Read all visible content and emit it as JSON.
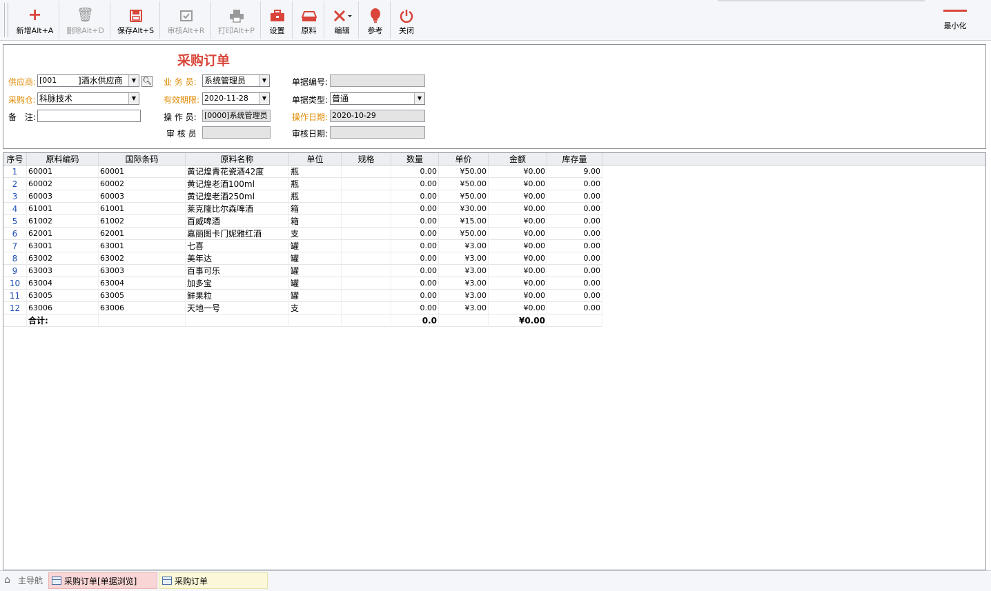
{
  "toolbar": {
    "buttons": [
      {
        "label": "新增Alt+A",
        "icon": "plus-icon",
        "color": "#d9453a"
      },
      {
        "label": "删除Alt+D",
        "icon": "trash-icon",
        "color": "#9a9a9a"
      },
      {
        "label": "保存Alt+S",
        "icon": "save-icon",
        "color": "#d9453a"
      },
      {
        "label": "审核Alt+R",
        "icon": "approve-icon",
        "color": "#9a9a9a"
      },
      {
        "label": "打印Alt+P",
        "icon": "print-icon",
        "color": "#9a9a9a"
      },
      {
        "label": "设置",
        "icon": "toolbox-icon",
        "color": "#d9453a"
      },
      {
        "label": "原料",
        "icon": "material-icon",
        "color": "#d9453a"
      },
      {
        "label": "编辑",
        "icon": "edit-tools-icon",
        "color": "#d9453a"
      },
      {
        "label": "参考",
        "icon": "bulb-icon",
        "color": "#d9453a"
      },
      {
        "label": "关闭",
        "icon": "power-icon",
        "color": "#d9453a"
      }
    ],
    "minimize_label": "最小化"
  },
  "form": {
    "title": "采购订单",
    "supplier_label": "供应商:",
    "supplier_code": "[001",
    "supplier_name": "]酒水供应商",
    "warehouse_label": "采购仓:",
    "warehouse_value": "科脉技术",
    "remark_label": "备　注:",
    "remark_value": "",
    "salesman_label": "业 务 员:",
    "salesman_value": "系统管理员",
    "valid_label": "有效期限:",
    "valid_value": "2020-11-28",
    "operator_label": "操 作 员:",
    "operator_value": "[0000]系统管理员",
    "auditor_label": "审 核 员",
    "auditor_value": "",
    "docno_label": "单据编号:",
    "docno_value": "",
    "doctype_label": "单据类型:",
    "doctype_value": "普通",
    "opdate_label": "操作日期:",
    "opdate_value": "2020-10-29",
    "auditdate_label": "审核日期:",
    "auditdate_value": ""
  },
  "grid": {
    "headers": [
      "序号",
      "原料编码",
      "国际条码",
      "原料名称",
      "单位",
      "规格",
      "数量",
      "单价",
      "金额",
      "库存量"
    ],
    "rows": [
      {
        "idx": "1",
        "code": "60001",
        "barcode": "60001",
        "name": "黄记煌青花瓷酒42度",
        "unit": "瓶",
        "spec": "",
        "qty": "0.00",
        "price": "¥50.00",
        "amount": "¥0.00",
        "stock": "9.00"
      },
      {
        "idx": "2",
        "code": "60002",
        "barcode": "60002",
        "name": "黄记煌老酒100ml",
        "unit": "瓶",
        "spec": "",
        "qty": "0.00",
        "price": "¥50.00",
        "amount": "¥0.00",
        "stock": "0.00"
      },
      {
        "idx": "3",
        "code": "60003",
        "barcode": "60003",
        "name": "黄记煌老酒250ml",
        "unit": "瓶",
        "spec": "",
        "qty": "0.00",
        "price": "¥50.00",
        "amount": "¥0.00",
        "stock": "0.00"
      },
      {
        "idx": "4",
        "code": "61001",
        "barcode": "61001",
        "name": "莱克隆比尔森啤酒",
        "unit": "箱",
        "spec": "",
        "qty": "0.00",
        "price": "¥30.00",
        "amount": "¥0.00",
        "stock": "0.00"
      },
      {
        "idx": "5",
        "code": "61002",
        "barcode": "61002",
        "name": "百威啤酒",
        "unit": "箱",
        "spec": "",
        "qty": "0.00",
        "price": "¥15.00",
        "amount": "¥0.00",
        "stock": "0.00"
      },
      {
        "idx": "6",
        "code": "62001",
        "barcode": "62001",
        "name": "嘉丽图卡门妮雅红酒",
        "unit": "支",
        "spec": "",
        "qty": "0.00",
        "price": "¥50.00",
        "amount": "¥0.00",
        "stock": "0.00"
      },
      {
        "idx": "7",
        "code": "63001",
        "barcode": "63001",
        "name": "七喜",
        "unit": "罐",
        "spec": "",
        "qty": "0.00",
        "price": "¥3.00",
        "amount": "¥0.00",
        "stock": "0.00"
      },
      {
        "idx": "8",
        "code": "63002",
        "barcode": "63002",
        "name": "美年达",
        "unit": "罐",
        "spec": "",
        "qty": "0.00",
        "price": "¥3.00",
        "amount": "¥0.00",
        "stock": "0.00"
      },
      {
        "idx": "9",
        "code": "63003",
        "barcode": "63003",
        "name": "百事可乐",
        "unit": "罐",
        "spec": "",
        "qty": "0.00",
        "price": "¥3.00",
        "amount": "¥0.00",
        "stock": "0.00"
      },
      {
        "idx": "10",
        "code": "63004",
        "barcode": "63004",
        "name": "加多宝",
        "unit": "罐",
        "spec": "",
        "qty": "0.00",
        "price": "¥3.00",
        "amount": "¥0.00",
        "stock": "0.00"
      },
      {
        "idx": "11",
        "code": "63005",
        "barcode": "63005",
        "name": "鲜果粒",
        "unit": "罐",
        "spec": "",
        "qty": "0.00",
        "price": "¥3.00",
        "amount": "¥0.00",
        "stock": "0.00"
      },
      {
        "idx": "12",
        "code": "63006",
        "barcode": "63006",
        "name": "天地一号",
        "unit": "支",
        "spec": "",
        "qty": "0.00",
        "price": "¥3.00",
        "amount": "¥0.00",
        "stock": "0.00"
      }
    ],
    "total": {
      "label": "合计:",
      "qty": "0.0",
      "amount": "¥0.00"
    }
  },
  "statusbar": {
    "home": "主导航",
    "tab1": "采购订单[单据浏览]",
    "tab2": "采购订单"
  }
}
